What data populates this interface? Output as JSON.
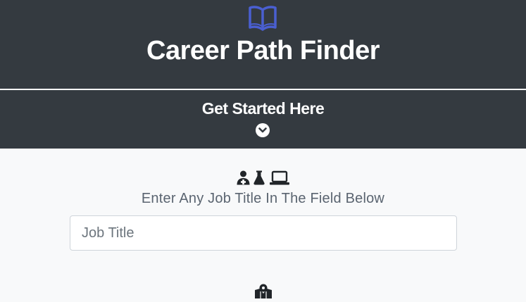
{
  "header": {
    "icon": "book-open-icon",
    "title": "Career Path Finder",
    "icon_color": "#4a5fd1",
    "background": "#343a40"
  },
  "get_started": {
    "label": "Get Started Here",
    "icon": "chevron-circle-down-icon"
  },
  "main": {
    "icons": [
      "user-doctor-icon",
      "flask-icon",
      "laptop-icon"
    ],
    "instruction": "Enter Any Job Title In The Field Below",
    "job_input": {
      "placeholder": "Job Title",
      "value": ""
    },
    "bottom_icon": "map-icon"
  }
}
